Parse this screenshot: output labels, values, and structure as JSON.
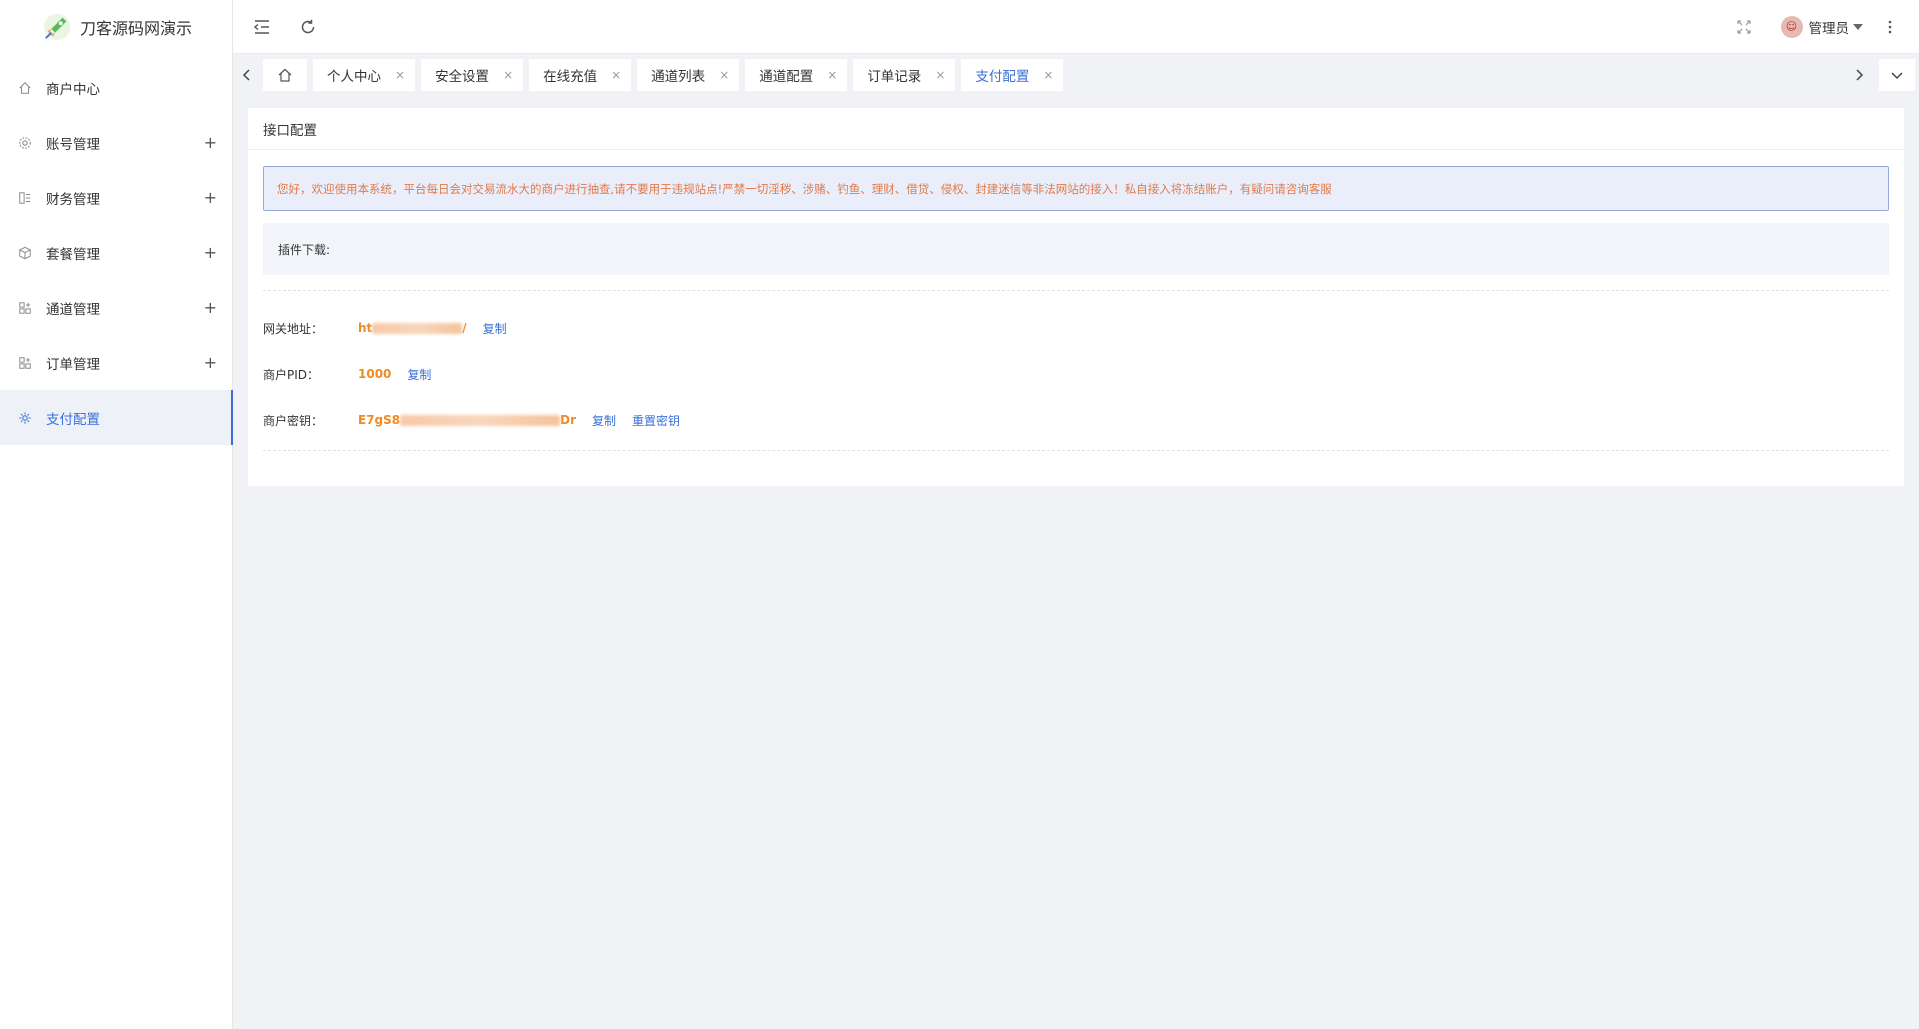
{
  "app": {
    "title": "刀客源码网演示"
  },
  "sidebar": {
    "items": [
      {
        "label": "商户中心",
        "icon": "home-icon",
        "expandable": false,
        "active": false
      },
      {
        "label": "账号管理",
        "icon": "gear-icon",
        "expandable": true,
        "active": false
      },
      {
        "label": "财务管理",
        "icon": "finance-icon",
        "expandable": true,
        "active": false
      },
      {
        "label": "套餐管理",
        "icon": "package-icon",
        "expandable": true,
        "active": false
      },
      {
        "label": "通道管理",
        "icon": "grid-icon",
        "expandable": true,
        "active": false
      },
      {
        "label": "订单管理",
        "icon": "grid-icon",
        "expandable": true,
        "active": false
      },
      {
        "label": "支付配置",
        "icon": "config-icon",
        "expandable": false,
        "active": true
      }
    ],
    "expand_symbol": "+"
  },
  "header": {
    "user": "管理员"
  },
  "tabs": [
    {
      "label": "个人中心",
      "close": "×"
    },
    {
      "label": "安全设置",
      "close": "×"
    },
    {
      "label": "在线充值",
      "close": "×"
    },
    {
      "label": "通道列表",
      "close": "×"
    },
    {
      "label": "通道配置",
      "close": "×"
    },
    {
      "label": "订单记录",
      "close": "×"
    },
    {
      "label": "支付配置",
      "close": "×",
      "active": true
    }
  ],
  "card": {
    "title": "接口配置",
    "notice": "您好，欢迎使用本系统，平台每日会对交易流水大的商户进行抽查,请不要用于违规站点!严禁一切淫秽、涉赌、钓鱼、理财、借贷、侵权、封建迷信等非法网站的接入！私自接入将冻结账户，有疑问请咨询客服",
    "plugin_label": "插件下载:",
    "gateway": {
      "label": "网关地址：",
      "value_prefix": "ht",
      "value_suffix": "/",
      "copy": "复制"
    },
    "pid": {
      "label": "商户PID：",
      "value": "1000",
      "copy": "复制"
    },
    "secret": {
      "label": "商户密钥：",
      "value_prefix": "E7gS8",
      "value_suffix": "Dr",
      "copy": "复制",
      "reset": "重置密钥"
    }
  },
  "colors": {
    "accent": "#3a6fd8",
    "warning_text": "#e07a4a",
    "value_orange": "#f08a24"
  }
}
